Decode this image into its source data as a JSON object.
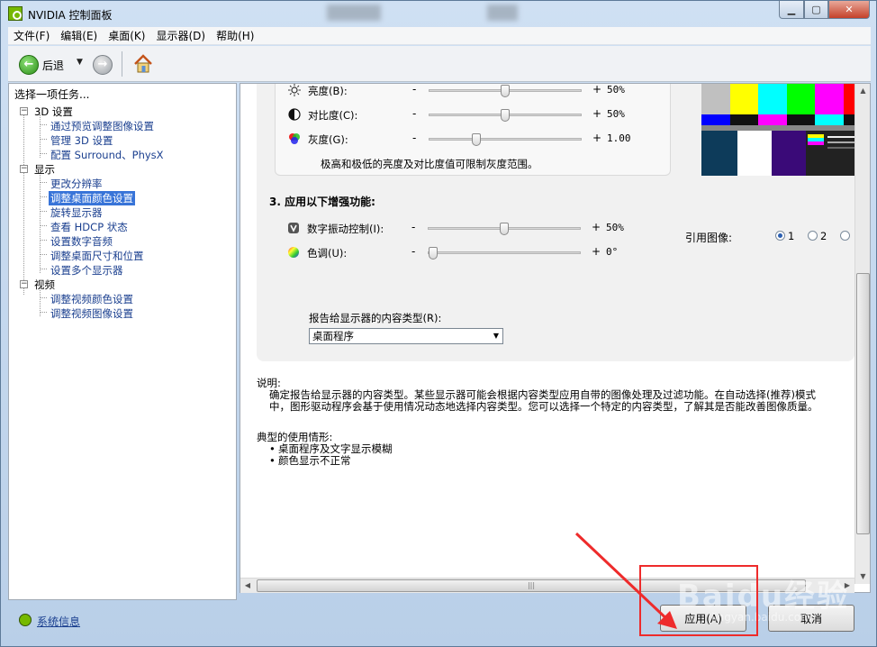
{
  "window": {
    "title": "NVIDIA 控制面板"
  },
  "menu": [
    "文件(F)",
    "编辑(E)",
    "桌面(K)",
    "显示器(D)",
    "帮助(H)"
  ],
  "toolbar": {
    "back_label": "后退"
  },
  "left_pane": {
    "header": "选择一项任务...",
    "categories": [
      {
        "label": "3D 设置",
        "items": [
          "通过预览调整图像设置",
          "管理 3D 设置",
          "配置 Surround、PhysX"
        ]
      },
      {
        "label": "显示",
        "items": [
          "更改分辨率",
          "调整桌面颜色设置",
          "旋转显示器",
          "查看 HDCP 状态",
          "设置数字音频",
          "调整桌面尺寸和位置",
          "设置多个显示器"
        ]
      },
      {
        "label": "视频",
        "items": [
          "调整视频颜色设置",
          "调整视频图像设置"
        ]
      }
    ],
    "selected_item": "调整桌面颜色设置"
  },
  "color_controls": [
    {
      "label": "亮度(B):",
      "value": "50%",
      "level": 0.5,
      "icon": "sun-icon"
    },
    {
      "label": "对比度(C):",
      "value": "50%",
      "level": 0.5,
      "icon": "contrast-icon"
    },
    {
      "label": "灰度(G):",
      "value": "1.00",
      "level": 0.3,
      "icon": "gamma-icon"
    }
  ],
  "range_note": "极高和极低的亮度及对比度值可限制灰度范围。",
  "section3": {
    "title": "3. 应用以下增强功能:",
    "controls": [
      {
        "label": "数字振动控制(I):",
        "value": "50%",
        "level": 0.5,
        "icon": "vibrance-icon"
      },
      {
        "label": "色调(U):",
        "value": "0°",
        "level": 0.0,
        "icon": "hue-icon"
      }
    ]
  },
  "reference_image": {
    "label": "引用图像:",
    "options": [
      "1",
      "2"
    ],
    "selected": "1"
  },
  "content_type": {
    "label": "报告给显示器的内容类型(R):",
    "value": "桌面程序"
  },
  "description": {
    "title": "说明:",
    "lines": [
      "确定报告给显示器的内容类型。某些显示器可能会根据内容类型应用自带的图像处理及过滤功能。在自动选择(推荐)模式",
      "中，图形驱动程序会基于使用情况动态地选择内容类型。您可以选择一个特定的内容类型，了解其是否能改善图像质量。"
    ]
  },
  "usage": {
    "title": "典型的使用情形:",
    "items": [
      "桌面程序及文字显示模糊",
      "颜色显示不正常"
    ]
  },
  "footer": {
    "system_info": "系统信息",
    "apply": "应用(A)",
    "cancel": "取消"
  },
  "watermark": {
    "main": "Baidu经验",
    "sub": "jingyan.baidu.com"
  },
  "colors": {
    "selection": "#3874d8",
    "annotation": "#ee2b2b",
    "nvidia_green": "#76b900"
  }
}
